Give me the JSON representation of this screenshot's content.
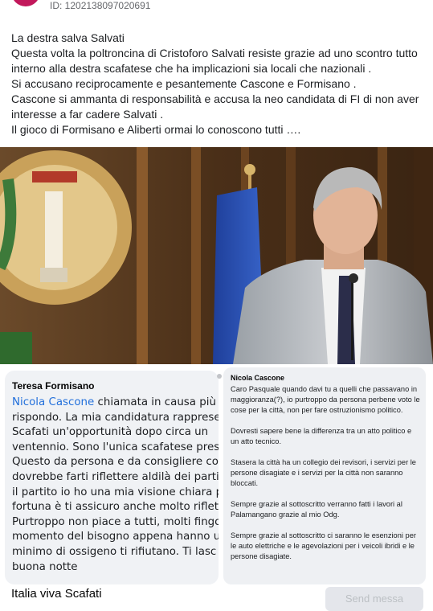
{
  "post": {
    "id_label": "ID: 1202138097020691",
    "paragraphs": [
      "La destra salva Salvati",
      "Questa volta la poltroncina di Cristoforo Salvati resiste grazie ad uno scontro tutto interno alla destra scafatese che ha implicazioni sia locali che nazionali .",
      "Si accusano reciprocamente e pesantemente Cascone e Formisano .",
      "Cascone si ammanta di responsabilità e accusa la neo candidata di FI di non aver interesse a far cadere Salvati .",
      "Il gioco di Formisano e Aliberti ormai lo conoscono tutti …."
    ]
  },
  "comment_left": {
    "author": "Teresa Formisano",
    "mention": "Nicola Cascone",
    "first_line_rest": " chiamata in causa più",
    "lines": [
      "rispondo. La mia candidatura rapprese",
      "Scafati un'opportunità dopo circa un",
      "ventennio. Sono l'unica scafatese pres",
      "Questo da persona e da consigliere co",
      "dovrebbe farti riflettere aldilà dei parti",
      "il partito io ho una mia visione chiara p",
      "fortuna è ti assicuro anche molto riflet",
      "Purtroppo non piace a tutti, molti fingo",
      "momento del bisogno appena hanno u",
      "minimo di ossigeno ti rifiutano. Ti lasc",
      "buona notte"
    ]
  },
  "comment_right": {
    "author": "Nicola Cascone",
    "paragraphs": [
      "Caro Pasquale quando davi tu a quelli che passavano in maggioranza(?), io purtroppo da persona perbene voto le cose per la città, non per fare ostruzionismo politico.",
      "Dovresti sapere bene la differenza tra un atto politico e un atto tecnico.",
      "Stasera la città ha un collegio dei revisori, i servizi per le persone disagiate e i servizi per la città non saranno bloccati.",
      "Sempre grazie al sottoscritto verranno fatti i lavori al Palamangano grazie al mio Odg.",
      "Sempre grazie al sottoscritto ci saranno le esenzioni per le auto elettriche e le agevolazioni per i veicoli ibridi e le persone disagiate."
    ]
  },
  "footer": {
    "page_name": "Italia viva Scafati",
    "send_label": "Send messa"
  },
  "colors": {
    "mention": "#216fdb",
    "avatar": "#c2185b"
  }
}
